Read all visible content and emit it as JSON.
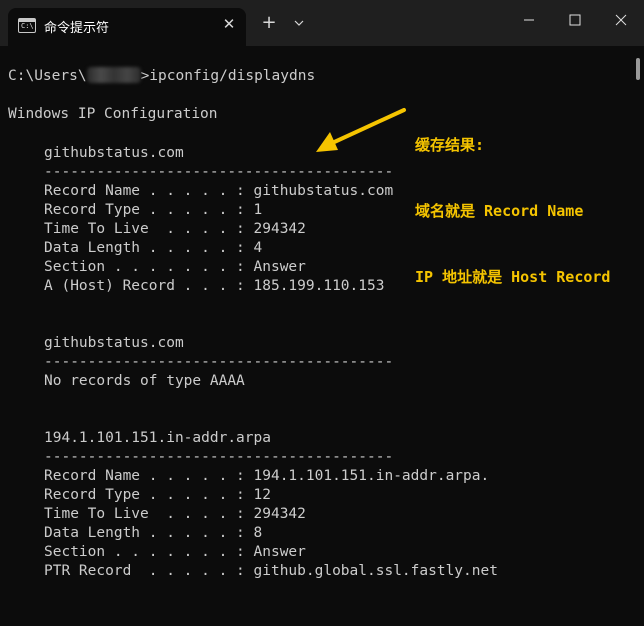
{
  "window": {
    "tab_title": "命令提示符",
    "tab_icon": "C:\\",
    "close_tab_glyph": "✕",
    "new_tab_glyph": "+",
    "dropdown_glyph": "⌄"
  },
  "terminal": {
    "prompt_prefix": "C:\\Users\\",
    "prompt_command": ">ipconfig/displaydns",
    "heading": "Windows IP Configuration",
    "entries": [
      {
        "name": "githubstatus.com",
        "separator": "----------------------------------------",
        "rows": [
          "Record Name . . . . . : githubstatus.com",
          "Record Type . . . . . : 1",
          "Time To Live  . . . . : 294342",
          "Data Length . . . . . : 4",
          "Section . . . . . . . : Answer",
          "A (Host) Record . . . : 185.199.110.153"
        ]
      },
      {
        "name": "githubstatus.com",
        "separator": "----------------------------------------",
        "rows": [
          "No records of type AAAA"
        ]
      },
      {
        "name": "194.1.101.151.in-addr.arpa",
        "separator": "----------------------------------------",
        "rows": [
          "Record Name . . . . . : 194.1.101.151.in-addr.arpa.",
          "Record Type . . . . . : 12",
          "Time To Live  . . . . : 294342",
          "Data Length . . . . . : 8",
          "Section . . . . . . . : Answer",
          "PTR Record  . . . . . : github.global.ssl.fastly.net"
        ]
      }
    ]
  },
  "annotation": {
    "line1": "缓存结果:",
    "line2": "域名就是 Record Name",
    "line3": "IP 地址就是 Host Record",
    "color": "#f5c400"
  }
}
